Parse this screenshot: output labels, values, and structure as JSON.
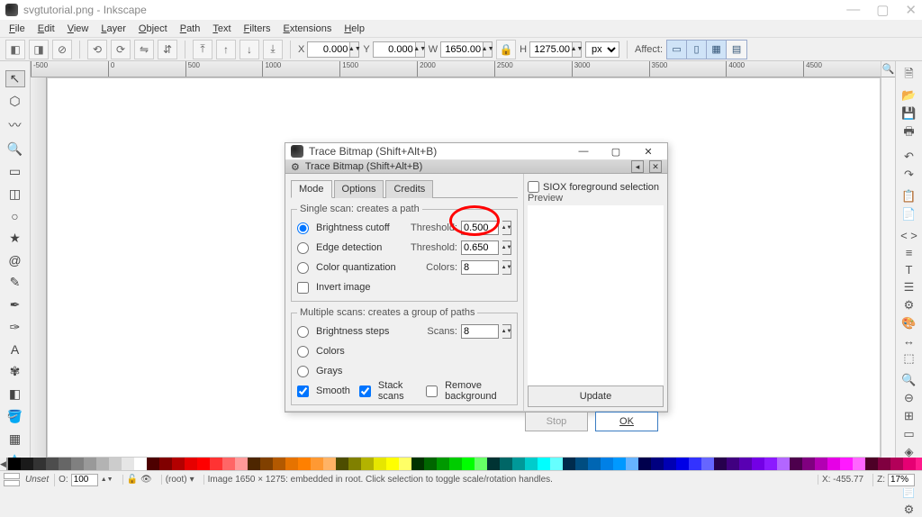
{
  "app": {
    "title": "svgtutorial.png - Inkscape",
    "window_buttons": {
      "minimize": "—",
      "maximize": "▢",
      "close": "✕"
    }
  },
  "menu": [
    "File",
    "Edit",
    "View",
    "Layer",
    "Object",
    "Path",
    "Text",
    "Filters",
    "Extensions",
    "Help"
  ],
  "options": {
    "x_label": "X",
    "x_value": "0.000",
    "y_label": "Y",
    "y_value": "0.000",
    "w_label": "W",
    "w_value": "1650.00",
    "h_label": "H",
    "h_value": "1275.00",
    "unit": "px",
    "affect_label": "Affect:"
  },
  "ruler_labels": [
    "-500",
    "0",
    "500",
    "1000",
    "1500",
    "2000",
    "2500",
    "3000",
    "3500",
    "4000",
    "4500"
  ],
  "dialog": {
    "outer_title": "Trace Bitmap (Shift+Alt+B)",
    "inner_title": "Trace Bitmap (Shift+Alt+B)",
    "tabs": [
      "Mode",
      "Options",
      "Credits"
    ],
    "siox_label": "SIOX foreground selection",
    "preview_label": "Preview",
    "single_scan_legend": "Single scan: creates a path",
    "rows": {
      "brightness": "Brightness cutoff",
      "threshold1_label": "Threshold:",
      "threshold1_value": "0.500",
      "edge": "Edge detection",
      "threshold2_label": "Threshold:",
      "threshold2_value": "0.650",
      "colorquant": "Color quantization",
      "colors_label": "Colors:",
      "colors_value": "8",
      "invert": "Invert image"
    },
    "multi_scan_legend": "Multiple scans: creates a group of paths",
    "multi": {
      "brightness_steps": "Brightness steps",
      "scans_label": "Scans:",
      "scans_value": "8",
      "colors": "Colors",
      "grays": "Grays",
      "smooth": "Smooth",
      "stack": "Stack scans",
      "remove_bg": "Remove background"
    },
    "update": "Update",
    "stop": "Stop",
    "ok": "OK"
  },
  "palette_colors": [
    "#000000",
    "#1a1a1a",
    "#333333",
    "#4d4d4d",
    "#666666",
    "#808080",
    "#999999",
    "#b3b3b3",
    "#cccccc",
    "#e6e6e6",
    "#ffffff",
    "#4d0000",
    "#800000",
    "#b30000",
    "#e60000",
    "#ff0000",
    "#ff3333",
    "#ff6666",
    "#ff9999",
    "#4d2600",
    "#804000",
    "#b35900",
    "#e67300",
    "#ff8000",
    "#ff9933",
    "#ffb366",
    "#4d4d00",
    "#808000",
    "#b3b300",
    "#e6e600",
    "#ffff00",
    "#ffff66",
    "#003300",
    "#006600",
    "#009900",
    "#00cc00",
    "#00ff00",
    "#66ff66",
    "#003333",
    "#006666",
    "#009999",
    "#00cccc",
    "#00ffff",
    "#66ffff",
    "#002b4d",
    "#004d80",
    "#0066b3",
    "#0080e6",
    "#0099ff",
    "#66b3ff",
    "#00004d",
    "#000080",
    "#0000b3",
    "#0000e6",
    "#3333ff",
    "#6666ff",
    "#26004d",
    "#400080",
    "#5900b3",
    "#7300e6",
    "#8c1aff",
    "#b366ff",
    "#4d004d",
    "#800080",
    "#b300b3",
    "#e600e6",
    "#ff1aff",
    "#ff66ff",
    "#4d0026",
    "#800040",
    "#b30059",
    "#e60073",
    "#ff1a8c",
    "#ff66b3",
    "#332200",
    "#5c3d00",
    "#8a6600",
    "#9e7a2e",
    "#c2a06b",
    "#dcc49a"
  ],
  "status": {
    "unset_label": "Unset",
    "opacity_label": "O:",
    "opacity_value": "100",
    "layer": "(root)",
    "message": "Image 1650 × 1275: embedded in root. Click selection to toggle scale/rotation handles.",
    "coord": "X: -455.77",
    "zoom_label": "Z:",
    "zoom_value": "17%"
  },
  "tool_names": [
    "selector",
    "node",
    "tweak",
    "zoom",
    "rect",
    "3dbox",
    "ellipse",
    "star",
    "spiral",
    "pencil",
    "bezier",
    "calligraphy",
    "text",
    "spray",
    "eraser",
    "bucket",
    "gradient",
    "dropper",
    "connector"
  ],
  "right_names": [
    "new",
    "open",
    "save",
    "print",
    "undo",
    "redo",
    "copy",
    "paste",
    "xml",
    "align",
    "text",
    "layers",
    "objprop",
    "fill",
    "transform",
    "trace",
    "zoom-in",
    "zoom-out",
    "zoom-fit",
    "zoom-page",
    "zoom-drawing",
    "fullscreen",
    "docprops",
    "prefs"
  ]
}
